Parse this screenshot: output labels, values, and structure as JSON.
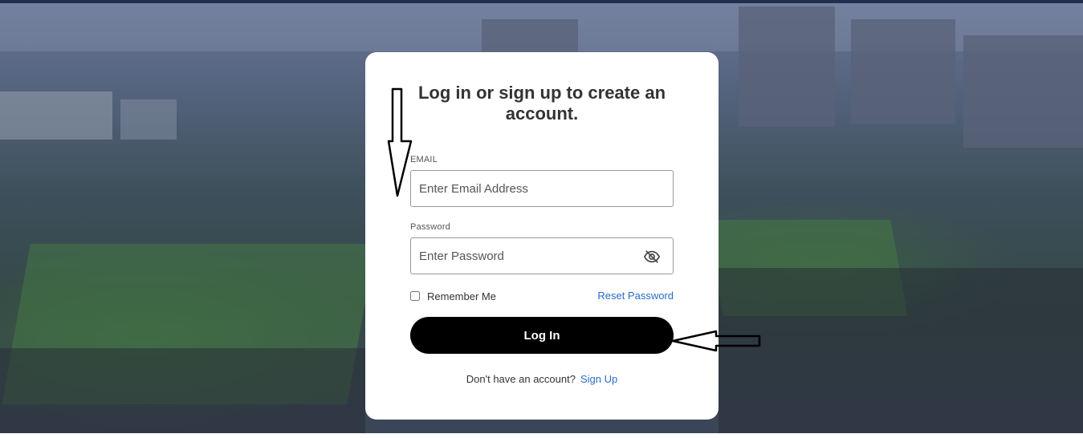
{
  "form": {
    "title": "Log in or sign up to create an account.",
    "email_label": "EMAIL",
    "email_placeholder": "Enter Email Address",
    "email_value": "",
    "password_label": "Password",
    "password_placeholder": "Enter Password",
    "password_value": "",
    "password_toggle_icon": "eye-slash-icon",
    "remember_label": "Remember Me",
    "remember_checked": false,
    "reset_label": "Reset Password",
    "login_label": "Log In",
    "signup_prompt": "Don't have an account?",
    "signup_link": "Sign Up"
  },
  "colors": {
    "link": "#2a6cc8",
    "button_bg": "#000000",
    "button_text": "#ffffff",
    "top_bar": "#1f2f4d"
  }
}
